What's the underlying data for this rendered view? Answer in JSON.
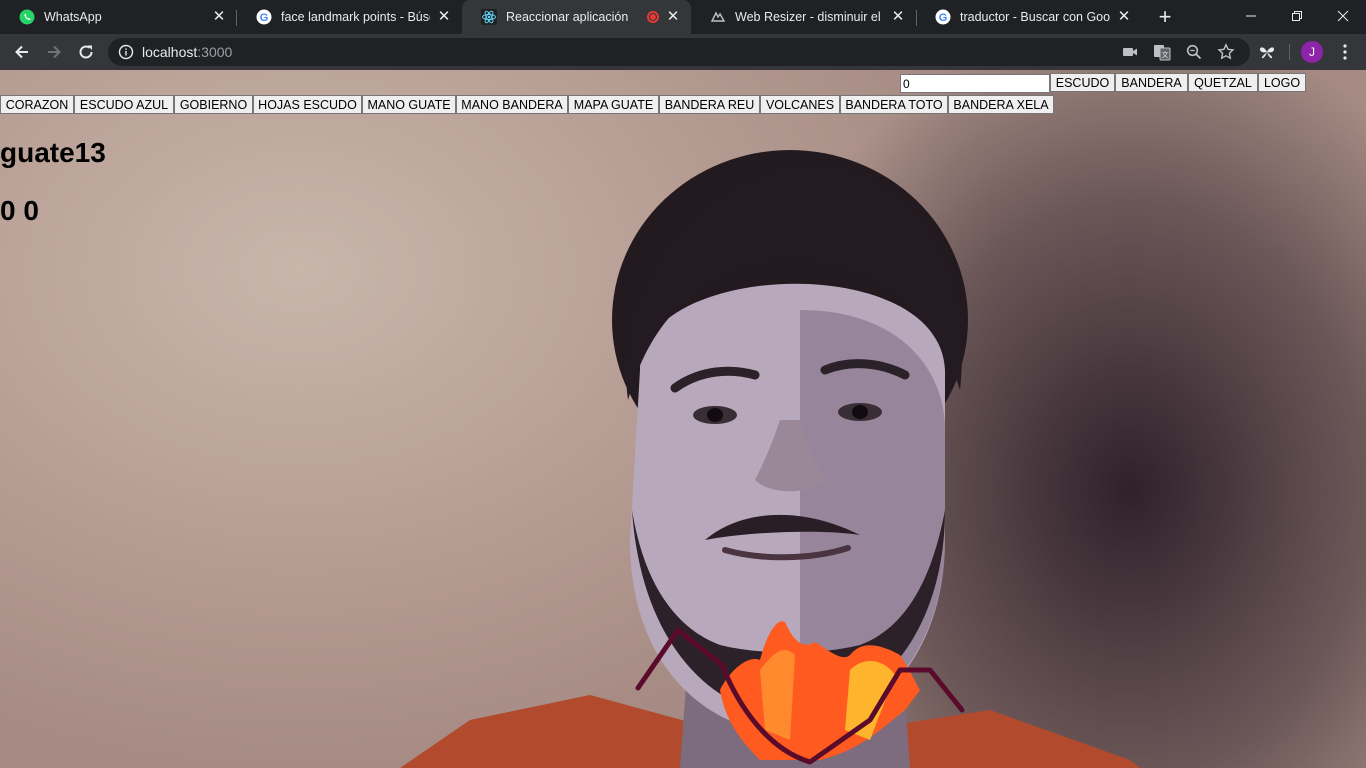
{
  "browser": {
    "tabs": [
      {
        "title": "WhatsApp",
        "icon": "whatsapp-icon",
        "active": false
      },
      {
        "title": "face landmark points - Búsque",
        "icon": "google-icon",
        "active": false
      },
      {
        "title": "Reaccionar aplicación",
        "icon": "react-icon",
        "active": true,
        "recording": true
      },
      {
        "title": "Web Resizer - disminuir el tam",
        "icon": "web-resizer-icon",
        "active": false
      },
      {
        "title": "traductor - Buscar con Google",
        "icon": "google-icon",
        "active": false
      }
    ],
    "url_host": "localhost",
    "url_port": ":3000",
    "profile_initial": "J"
  },
  "page": {
    "number_input_value": "0",
    "row1_buttons": [
      "ESCUDO",
      "BANDERA",
      "QUETZAL",
      "LOGO"
    ],
    "row2_buttons": [
      "CORAZON",
      "ESCUDO AZUL",
      "GOBIERNO",
      "HOJAS ESCUDO",
      "MANO GUATE",
      "MANO BANDERA",
      "MAPA GUATE",
      "BANDERA REU",
      "VOLCANES",
      "BANDERA TOTO",
      "BANDERA XELA"
    ],
    "filter_name": "guate13",
    "coords": "0 0"
  },
  "colors": {
    "tab_strip": "#202124",
    "toolbar": "#35363a",
    "accent_profile": "#8e24aa",
    "recording": "#e53935"
  }
}
